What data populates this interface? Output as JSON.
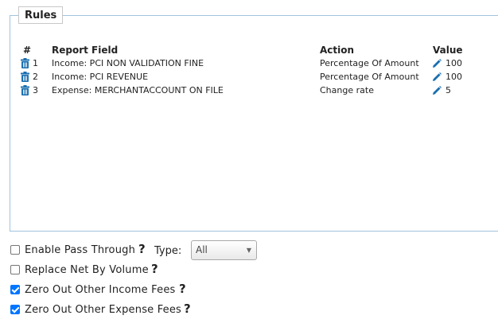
{
  "rules": {
    "legend": "Rules",
    "columns": {
      "num": "#",
      "field": "Report Field",
      "action": "Action",
      "value": "Value"
    },
    "rows": [
      {
        "num": "1",
        "field": "Income: PCI NON VALIDATION FINE",
        "action": "Percentage Of Amount",
        "value": "100"
      },
      {
        "num": "2",
        "field": "Income: PCI REVENUE",
        "action": "Percentage Of Amount",
        "value": "100"
      },
      {
        "num": "3",
        "field": "Expense: MERCHANTACCOUNT ON FILE",
        "action": "Change rate",
        "value": "5"
      }
    ]
  },
  "options": {
    "pass_through": {
      "label": "Enable Pass Through",
      "checked": false
    },
    "type_label": "Type:",
    "type_selected": "All",
    "replace_net": {
      "label": "Replace Net By Volume",
      "checked": false
    },
    "zero_income": {
      "label": "Zero Out Other Income Fees",
      "checked": true
    },
    "zero_expense": {
      "label": "Zero Out Other Expense Fees",
      "checked": true
    },
    "help_glyph": "?"
  },
  "icons": {
    "trash": "trash-icon",
    "pencil": "pencil-icon",
    "help": "help-icon"
  },
  "colors": {
    "icon_blue": "#1a6fb0",
    "checkbox_blue": "#0075ff",
    "fieldset_border": "#9fc3dc"
  }
}
